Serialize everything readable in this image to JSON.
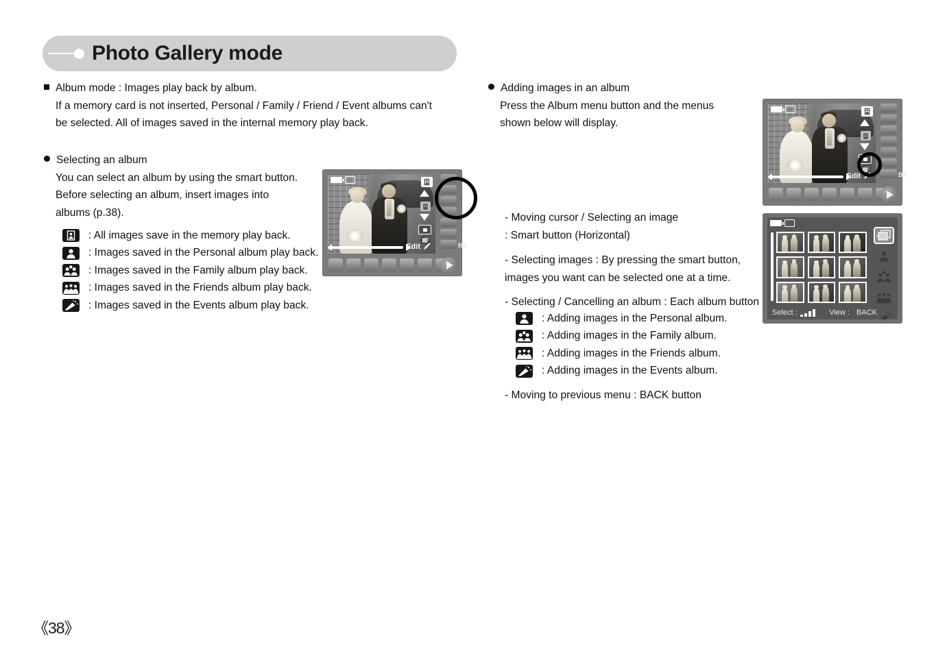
{
  "header": {
    "title": "Photo Gallery mode",
    "bar_color": "#cfcfcf"
  },
  "page_number": "《38》",
  "left_column": {
    "album_mode": {
      "bullet": "square",
      "lines": [
        "Album mode : Images play back by album.",
        "If a memory card is not inserted, Personal / Family / Friend / Event albums can't",
        "be selected. All of images saved in the internal memory play back."
      ]
    },
    "selecting_album": {
      "bullet": "round",
      "lines": [
        "Selecting an album",
        "You can select an album by using the smart button.",
        "Before selecting an album, insert images into",
        "albums (p.38)."
      ]
    },
    "album_legend": [
      {
        "icon": "all-images-icon",
        "label": ": All images save in the memory play back."
      },
      {
        "icon": "personal-album-icon",
        "label": ": Images saved in the Personal album play back."
      },
      {
        "icon": "family-album-icon",
        "label": ": Images saved in the Family album play back."
      },
      {
        "icon": "friends-album-icon",
        "label": ": Images saved in the Friends album play back."
      },
      {
        "icon": "events-album-icon",
        "label": ": Images saved in the Events album play back."
      }
    ]
  },
  "right_column": {
    "adding_images": {
      "bullet": "round",
      "lines": [
        "Adding images in an album",
        "Press the Album menu button and the menus",
        "shown below will display."
      ]
    },
    "instructions": [
      {
        "lines": [
          "- Moving cursor / Selecting an image",
          "  : Smart button (Horizontal)"
        ]
      },
      {
        "lines": [
          "- Selecting images : By pressing the smart button,",
          "  images you want can be selected one at a time."
        ]
      },
      {
        "lines": [
          "- Selecting / Cancelling an album : Each album button"
        ]
      }
    ],
    "album_legend": [
      {
        "icon": "personal-album-icon",
        "label": ": Adding images in the Personal album."
      },
      {
        "icon": "family-album-icon",
        "label": ": Adding images in the Family album."
      },
      {
        "icon": "friends-album-icon",
        "label": ": Adding images in the Friends album."
      },
      {
        "icon": "events-album-icon",
        "label": ": Adding images in the Events album."
      }
    ],
    "back_note": "- Moving to previous menu : BACK button"
  },
  "camera_left": {
    "osd": {
      "edit_label": "Edit",
      "back_label": "BA"
    }
  },
  "camera_top_right": {
    "osd": {
      "edit_label": "Edit",
      "back_label": "BA"
    }
  },
  "thumbnail_screen": {
    "select_label": "Select :",
    "view_label": "View :",
    "view_value": "BACK",
    "side_icons": [
      "album-menu-icon",
      "personal-album-icon",
      "family-album-icon",
      "friends-album-icon",
      "events-album-icon"
    ]
  }
}
